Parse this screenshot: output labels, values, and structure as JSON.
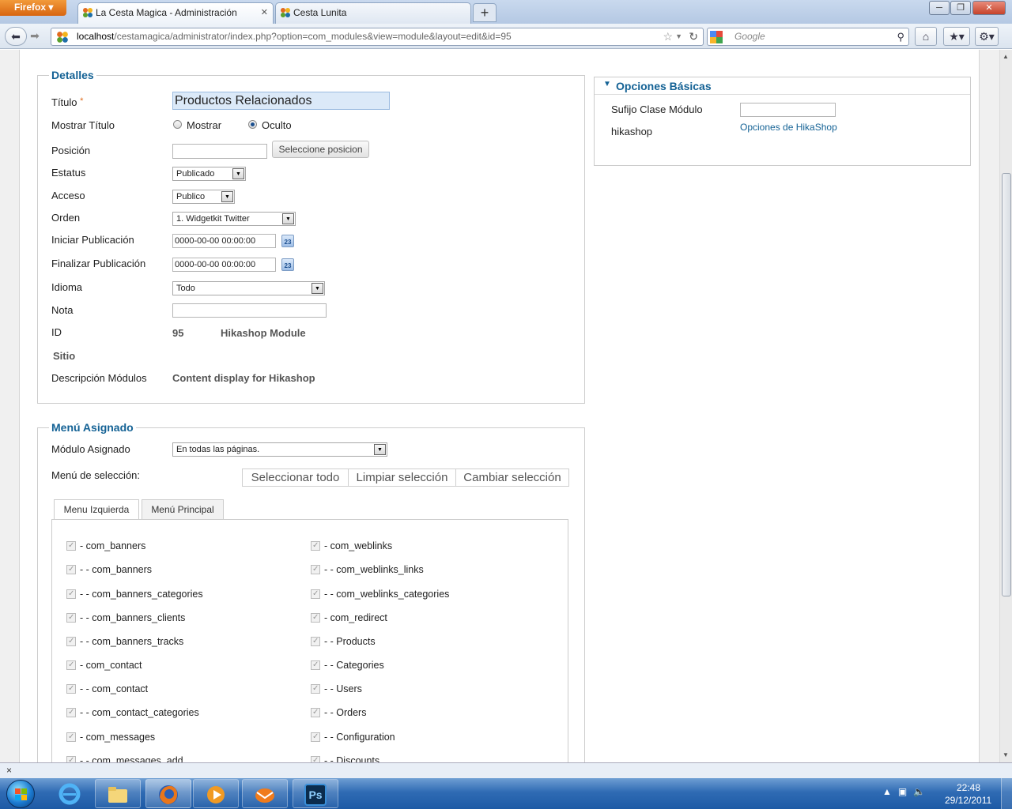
{
  "browser": {
    "app_button": "Firefox",
    "tabs": [
      {
        "label": "La Cesta Magica - Administración",
        "active": true
      },
      {
        "label": "Cesta Lunita",
        "active": false
      }
    ],
    "url_host": "localhost",
    "url_path": "/cestamagica/administrator/index.php?option=com_modules&view=module&layout=edit&id=95",
    "search_placeholder": "Google"
  },
  "detalles": {
    "legend": "Detalles",
    "titulo_label": "Título",
    "required_mark": "*",
    "titulo_value": "Productos Relacionados",
    "mostrar_titulo_label": "Mostrar Título",
    "mostrar_option": "Mostrar",
    "oculto_option": "Oculto",
    "posicion_label": "Posición",
    "posicion_value": "",
    "seleccione_button": "Seleccione posicion",
    "estatus_label": "Estatus",
    "estatus_value": "Publicado",
    "acceso_label": "Acceso",
    "acceso_value": "Publico",
    "orden_label": "Orden",
    "orden_value": "1. Widgetkit Twitter",
    "iniciar_label": "Iniciar Publicación",
    "iniciar_value": "0000-00-00 00:00:00",
    "finalizar_label": "Finalizar Publicación",
    "finalizar_value": "0000-00-00 00:00:00",
    "calendar_glyph": "23",
    "idioma_label": "Idioma",
    "idioma_value": "Todo",
    "nota_label": "Nota",
    "nota_value": "",
    "id_label": "ID",
    "id_value": "95",
    "module_type": "Hikashop Module",
    "sitio_label": "Sitio",
    "descripcion_label": "Descripción Módulos",
    "descripcion_value": "Content display for Hikashop"
  },
  "menu_asignado": {
    "legend": "Menú Asignado",
    "modulo_asignado_label": "Módulo Asignado",
    "modulo_asignado_value": "En todas las páginas.",
    "menu_seleccion_label": "Menú de selección:",
    "buttons": [
      "Seleccionar todo",
      "Limpiar selección",
      "Cambiar selección"
    ],
    "tabs": [
      "Menu Izquierda",
      "Menú Principal"
    ],
    "left_items": [
      "- com_banners",
      "- - com_banners",
      "- - com_banners_categories",
      "- - com_banners_clients",
      "- - com_banners_tracks",
      "- com_contact",
      "- - com_contact",
      "- - com_contact_categories",
      "- com_messages",
      "- - com_messages_add"
    ],
    "right_items": [
      "- com_weblinks",
      "- - com_weblinks_links",
      "- - com_weblinks_categories",
      "- com_redirect",
      "- - Products",
      "- - Categories",
      "- - Users",
      "- - Orders",
      "- - Configuration",
      "- - Discounts"
    ]
  },
  "opciones": {
    "header": "Opciones Básicas",
    "sufijo_label": "Sufijo Clase Módulo",
    "sufijo_value": "",
    "hikashop_label": "hikashop",
    "hikashop_link": "Opciones de HikaShop"
  },
  "statusbar": {
    "close_glyph": "×"
  },
  "taskbar": {
    "clock_time": "22:48",
    "clock_date": "29/12/2011",
    "apps": [
      "Internet Explorer",
      "Windows Explorer",
      "Firefox",
      "Media Player",
      "Mail",
      "Photoshop"
    ],
    "photoshop_label": "Ps"
  },
  "colors": {
    "accent": "#146295",
    "required": "#e06b1b",
    "taskbar": "#2f6bb4"
  }
}
